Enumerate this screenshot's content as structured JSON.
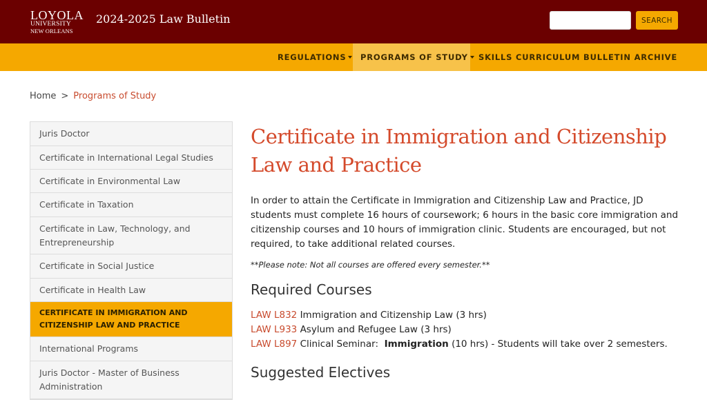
{
  "header": {
    "logo": {
      "line1": "LOYOLA",
      "line2": "UNIVERSITY",
      "line3": "NEW ORLEANS"
    },
    "site_title": "2024-2025 Law Bulletin",
    "search": {
      "placeholder": "",
      "button_label": "SEARCH"
    }
  },
  "nav": {
    "items": [
      {
        "label": "REGULATIONS",
        "has_dropdown": true
      },
      {
        "label": "PROGRAMS OF STUDY",
        "has_dropdown": true,
        "active": true
      },
      {
        "label": "SKILLS CURRICULUM",
        "has_dropdown": false
      },
      {
        "label": "BULLETIN ARCHIVE",
        "has_dropdown": false
      }
    ]
  },
  "breadcrumb": {
    "home": "Home",
    "separator": ">",
    "current": "Programs of Study"
  },
  "sidebar": {
    "items": [
      {
        "label": "Juris Doctor"
      },
      {
        "label": "Certificate in International Legal Studies"
      },
      {
        "label": "Certificate in Environmental Law"
      },
      {
        "label": "Certificate in Taxation"
      },
      {
        "label": "Certificate in Law, Technology, and Entrepreneurship"
      },
      {
        "label": "Certificate in Social Justice"
      },
      {
        "label": "Certificate in Health Law"
      },
      {
        "label": "CERTIFICATE IN IMMIGRATION AND CITIZENSHIP LAW AND PRACTICE",
        "active": true
      },
      {
        "label": "International Programs"
      },
      {
        "label": "Juris Doctor - Master of Business Administration"
      }
    ]
  },
  "main": {
    "title": "Certificate in Immigration and Citizenship Law and Practice",
    "intro": "In order to attain the Certificate in Immigration and Citizenship Law and Practice, JD students must complete 16 hours of coursework; 6 hours in the basic core immigration and citizenship courses and 10 hours of immigration clinic.  Students are encouraged, but not required, to take additional related courses.",
    "note": "**Please note: Not all courses are offered every semester.**",
    "required_heading": "Required Courses",
    "required_courses": [
      {
        "code": "LAW L832",
        "title": "Immigration and Citizenship Law (3 hrs)"
      },
      {
        "code": "LAW L933",
        "title": "Asylum and Refugee Law (3 hrs)"
      },
      {
        "code": "LAW L897",
        "title_prefix": "Clinical Seminar:  ",
        "title_bold": "Immigration",
        "title_suffix": " (10 hrs) - Students will take over 2 semesters."
      }
    ],
    "electives_heading": "Suggested Electives"
  },
  "colors": {
    "header_bg": "#6b0000",
    "accent_gold": "#f5a800",
    "link_red": "#c84b2e",
    "title_red": "#d44a2b"
  }
}
